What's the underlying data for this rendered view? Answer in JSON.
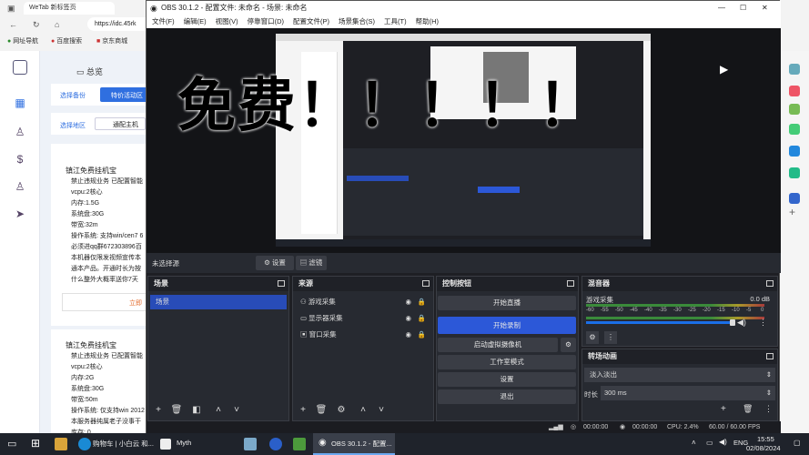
{
  "browser": {
    "tab_title": "WeTab 新标签页",
    "address": "https://idc.45rk",
    "bookmarks": [
      "网址导航",
      "百度搜索",
      "京东商城"
    ]
  },
  "page": {
    "brand_title": "总览",
    "tabs": [
      "选择备份",
      "特价活动区"
    ],
    "area_label": "选择地区",
    "area_button": "通配主机",
    "card1": {
      "title": "镇江免费挂机宝",
      "lines": [
        "禁止违规业务 已配置智能",
        "vcpu:2核心",
        "内存:1.5G",
        "系统盘:30G",
        "带宽:32m",
        "操作系统: 支持win/cen7 6",
        "必须进qq群672303896百",
        "本机器仅限发视频宣传本",
        "通本产品。开通时长为按",
        "什么整外大概率送你7天"
      ],
      "button": "立即"
    },
    "card2": {
      "title": "镇江免费挂机宝",
      "lines": [
        "禁止违规业务 已配置智能",
        "vcpu:2核心",
        "内存:2G",
        "系统盘:30G",
        "带宽:50m",
        "操作系统: 仅支持win 2012",
        "本服务器纯属老子没事干",
        "库存:    0"
      ]
    }
  },
  "obs": {
    "title": "OBS 30.1.2 - 配置文件: 未命名 - 场景: 未命名",
    "menu": [
      "文件(F)",
      "编辑(E)",
      "视图(V)",
      "停靠窗口(D)",
      "配置文件(P)",
      "场景集合(S)",
      "工具(T)",
      "帮助(H)"
    ],
    "overlay_text": "免费！！！！！",
    "no_source": "未选择源",
    "settings_label": "设置",
    "filters_label": "滤镜",
    "scenes_header": "场景",
    "scene_items": [
      "场景"
    ],
    "sources_header": "来源",
    "source_items": [
      "游戏采集",
      "显示器采集",
      "窗口采集"
    ],
    "controls_header": "控制按钮",
    "controls": {
      "stream": "开始直播",
      "record": "开始录制",
      "virtualcam": "启动虚拟摄像机",
      "studio": "工作室模式",
      "settings": "设置",
      "exit": "退出"
    },
    "mixer_header": "混音器",
    "mixer_track": "游戏采集",
    "mixer_db": "0.0 dB",
    "mixer_scale": [
      "-60",
      "-55",
      "-50",
      "-45",
      "-40",
      "-35",
      "-30",
      "-25",
      "-20",
      "-15",
      "-10",
      "-5",
      "0"
    ],
    "transitions_header": "转场动画",
    "transition_type": "淡入淡出",
    "duration_label": "时长",
    "duration_value": "300 ms",
    "status": {
      "stream_time": "00:00:00",
      "rec_time": "00:00:00",
      "cpu": "CPU: 2.4%",
      "fps": "60.00 / 60.00 FPS"
    }
  },
  "taskbar": {
    "items": [
      "购物车 | 小白云 和...",
      "Myth",
      "OBS 30.1.2 - 配置..."
    ],
    "lang": "ENG",
    "time": "15:55",
    "date": "02/08/2024"
  },
  "colors": {
    "obs_bg": "#1e1f24",
    "dock_bg": "#272a31",
    "selected_blue": "#284cb8",
    "record_blue": "#2c58d8",
    "accent_blue": "#1a6fe8"
  }
}
